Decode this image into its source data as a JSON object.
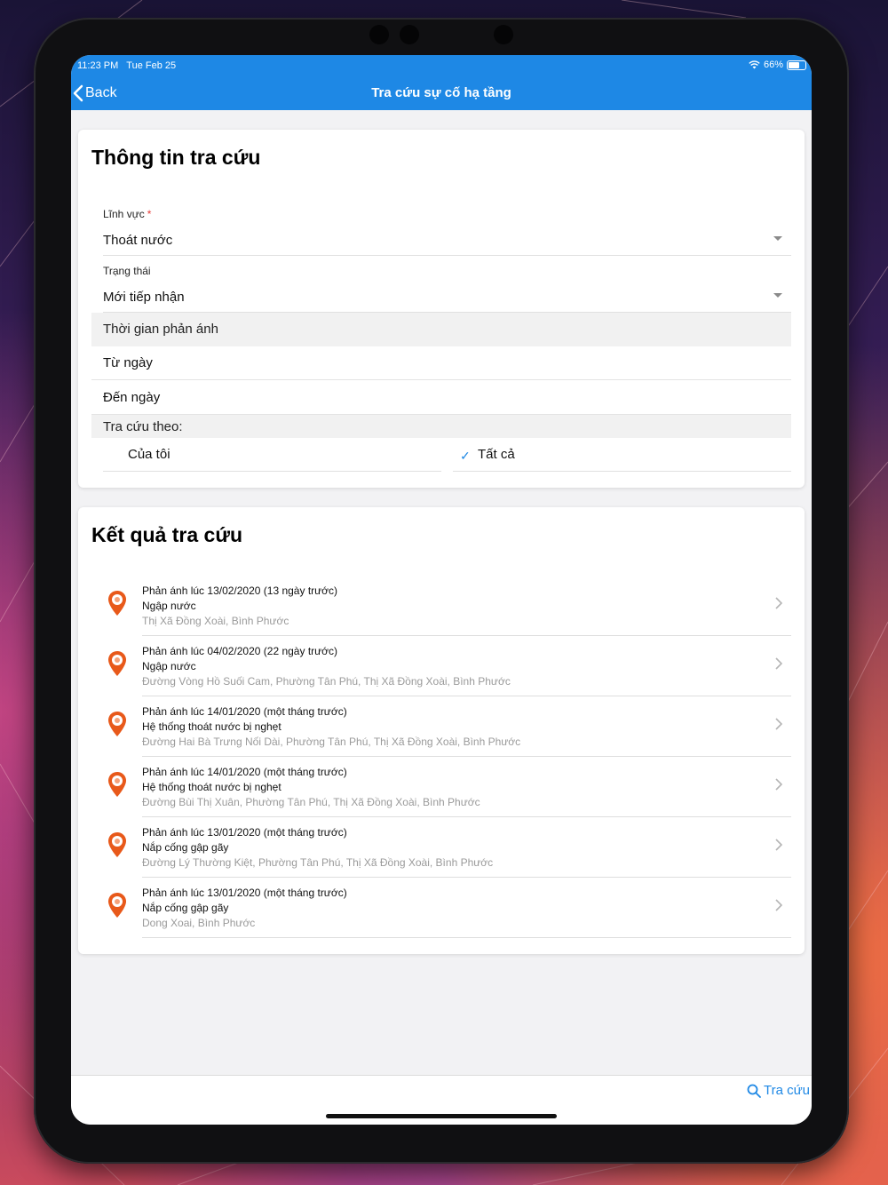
{
  "statusbar": {
    "time": "11:23 PM",
    "date": "Tue Feb 25",
    "battery": "66%",
    "battery_level": 0.66
  },
  "navbar": {
    "back_label": "Back",
    "title": "Tra cứu sự cố hạ tầng"
  },
  "search_info": {
    "title": "Thông tin tra cứu",
    "field_label": "Lĩnh vực",
    "required_mark": "*",
    "field_value": "Thoát nước",
    "status_label": "Trạng thái",
    "status_value": "Mới tiếp nhận",
    "time_section": "Thời gian phản ánh",
    "from_date": "Từ ngày",
    "to_date": "Đến ngày",
    "lookup_by": "Tra cứu theo:",
    "option_mine": "Của tôi",
    "option_all": "Tất cả",
    "option_all_checked": true
  },
  "results": {
    "title": "Kết quả tra cứu",
    "items": [
      {
        "time": "Phản ánh lúc 13/02/2020 (13 ngày trước)",
        "type": "Ngập nước",
        "address": "Thị Xã Đồng Xoài, Bình Phước"
      },
      {
        "time": "Phản ánh lúc 04/02/2020 (22 ngày trước)",
        "type": "Ngập nước",
        "address": "Đường Vòng Hồ Suối Cam, Phường Tân Phú, Thị Xã Đồng Xoài, Bình Phước"
      },
      {
        "time": "Phản ánh lúc 14/01/2020 (một tháng trước)",
        "type": "Hệ thống thoát nước bị nghẹt",
        "address": "Đường Hai Bà Trưng Nối Dài, Phường Tân Phú, Thị Xã Đồng Xoài, Bình Phước"
      },
      {
        "time": "Phản ánh lúc 14/01/2020 (một tháng trước)",
        "type": "Hệ thống thoát nước bị nghẹt",
        "address": "Đường Bùi Thị Xuân, Phường Tân Phú, Thị Xã Đồng Xoài, Bình Phước"
      },
      {
        "time": "Phản ánh lúc 13/01/2020 (một tháng trước)",
        "type": "Nắp cống gập gãy",
        "address": "Đường Lý Thường Kiệt, Phường Tân Phú, Thị Xã Đồng Xoài, Bình Phước"
      },
      {
        "time": "Phản ánh lúc 13/01/2020 (một tháng trước)",
        "type": "Nắp cống gập gãy",
        "address": "Dong Xoai, Bình Phước"
      }
    ]
  },
  "bottom_bar": {
    "search_label": "Tra cứu"
  },
  "colors": {
    "accent": "#1e88e5",
    "pin": "#e8591a",
    "required": "#e53935"
  }
}
